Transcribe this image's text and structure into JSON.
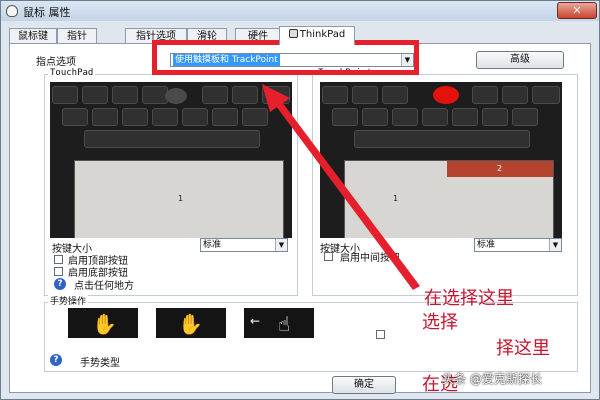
{
  "window": {
    "title": "鼠标 属性",
    "close_label": "✕"
  },
  "tabs": [
    {
      "label": "鼠标键"
    },
    {
      "label": "指针"
    },
    {
      "label": "指针选项"
    },
    {
      "label": "滑轮"
    },
    {
      "label": "硬件"
    },
    {
      "label": "ThinkPad"
    }
  ],
  "pointing": {
    "label": "指点选项",
    "selected": "使用触摸板和 TrackPoint",
    "advanced_label": "高级"
  },
  "touchpad": {
    "title": "TouchPad",
    "zone_label": "1",
    "button_size_label": "按键大小",
    "button_size_value": "标准",
    "top_buttons_label": "启用顶部按钮",
    "bottom_buttons_label": "启用底部按钮",
    "click_anywhere_label": "点击任何地方"
  },
  "trackpoint": {
    "title": "TrackPoint",
    "zone1_label": "1",
    "zone2_label": "2",
    "button_size_label": "按键大小",
    "button_size_value": "标准",
    "middle_button_label": "启用中间按钮"
  },
  "gestures": {
    "title": "手势操作",
    "type_label": "手势类型"
  },
  "footer": {
    "ok_label": "确定"
  },
  "annotations": {
    "line1": "在选择这里",
    "line2": "选择",
    "line3": "择这里",
    "line4": "在选"
  },
  "watermark": "头条 @爱克斯探长",
  "colors": {
    "annotation_red": "#e5202c",
    "selection_blue": "#3399ff",
    "trackpoint_dot": "#e3120b",
    "zone2": "#b4432f"
  }
}
